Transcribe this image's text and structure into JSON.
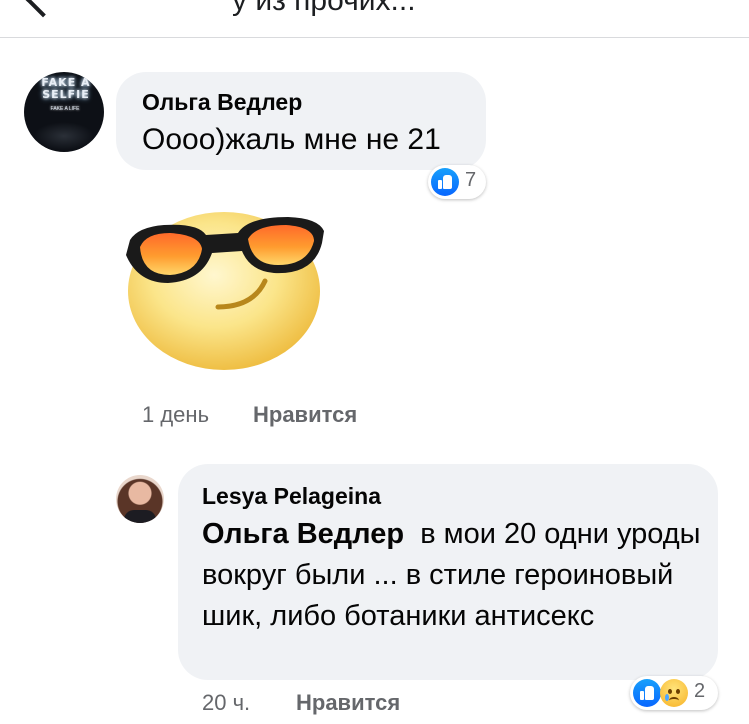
{
  "header": {
    "title": "у из прочих..."
  },
  "comment": {
    "author": "Ольга Ведлер",
    "avatar_text": "FAKE A SELFIE",
    "avatar_subtext": "FAKE A LIFE",
    "text": "Oooo)жаль мне не 21",
    "reaction_count": "7",
    "time": "1 день",
    "like_label": "Нравится",
    "sticker": "sunglasses-smiley"
  },
  "reply": {
    "author": "Lesya Pelageina",
    "mention": "Ольга Ведлер",
    "text": "в мои 20 одни уроды вокруг были ... в стиле героиновый шик, либо ботаники антисекс",
    "reaction_count": "2",
    "time": "20 ч.",
    "like_label": "Нравится"
  },
  "colors": {
    "bubble": "#f0f2f5",
    "meta_text": "#65676b",
    "like_blue": "#0866ff",
    "divider": "#d9dadd"
  }
}
